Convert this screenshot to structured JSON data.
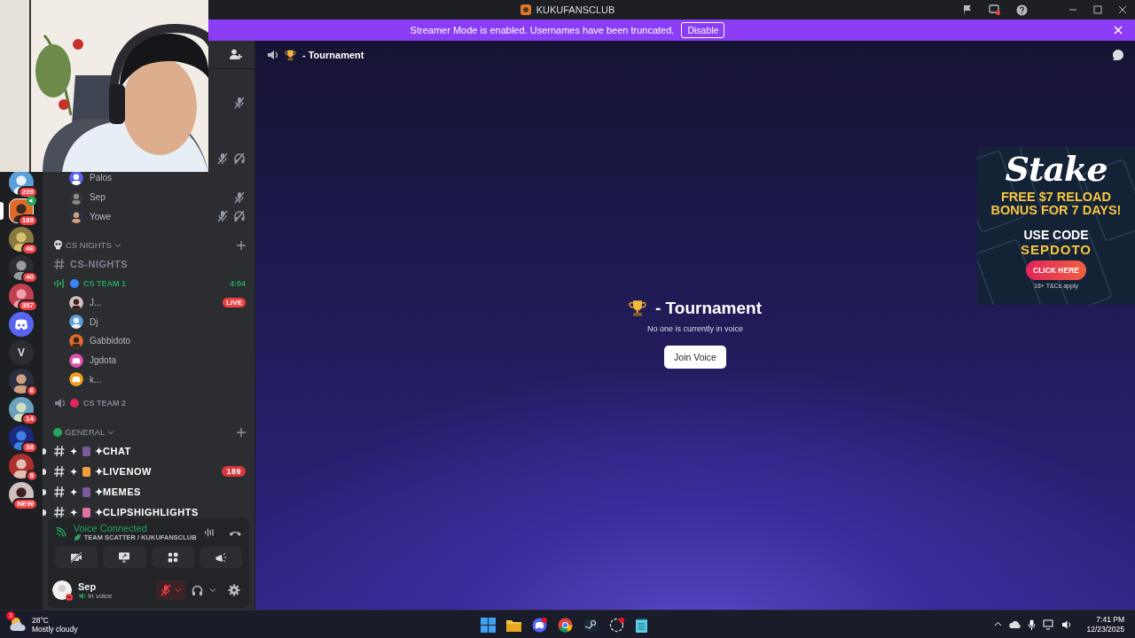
{
  "window": {
    "title": "KUKUFANSCLUB"
  },
  "banner": {
    "text": "Streamer Mode is enabled. Usernames have been truncated.",
    "button": "Disable"
  },
  "servers": [
    {
      "kind": "avatar",
      "badge": "239",
      "selected": false,
      "in_voice": false
    },
    {
      "kind": "avatar",
      "badge": "189",
      "selected": true,
      "in_voice": true
    },
    {
      "kind": "avatar",
      "badge": "46",
      "selected": false,
      "in_voice": false
    },
    {
      "kind": "avatar",
      "badge": "40",
      "selected": false,
      "in_voice": false
    },
    {
      "kind": "avatar",
      "badge": "357",
      "selected": false,
      "in_voice": false
    },
    {
      "kind": "discord",
      "selected": false,
      "in_voice": false
    },
    {
      "kind": "letter",
      "label": "V",
      "selected": false,
      "in_voice": false
    },
    {
      "kind": "avatar",
      "badge": "6",
      "selected": false,
      "in_voice": false
    },
    {
      "kind": "avatar",
      "badge": "14",
      "selected": false,
      "in_voice": false
    },
    {
      "kind": "avatar",
      "badge": "38",
      "selected": false,
      "in_voice": false
    },
    {
      "kind": "avatar",
      "badge": "8",
      "selected": false,
      "in_voice": false
    },
    {
      "kind": "avatar",
      "badge": "NEW",
      "selected": false,
      "in_voice": false
    }
  ],
  "channels": [
    {
      "kind": "member",
      "muted": true,
      "deafened": false
    },
    {
      "kind": "member",
      "muted": true,
      "deafened": true
    },
    {
      "kind": "member",
      "name": "Palos",
      "muted": false,
      "deafened": false
    },
    {
      "kind": "member",
      "name": "Sep",
      "muted": true,
      "deafened": false
    },
    {
      "kind": "member",
      "name": "Yowe",
      "muted": true,
      "deafened": true
    },
    {
      "kind": "category",
      "name": "CS NIGHTS"
    },
    {
      "kind": "text",
      "name": "CS-NIGHTS",
      "unread": false
    },
    {
      "kind": "voice",
      "name": "CS TEAM 1",
      "color": "#3b82f6",
      "active": true,
      "timer": "4:04"
    },
    {
      "kind": "member",
      "name": "J...",
      "muted": false,
      "deafened": false,
      "badge": "LIVE"
    },
    {
      "kind": "member",
      "name": "Dj",
      "muted": false,
      "deafened": false
    },
    {
      "kind": "member",
      "name": "Gabbidoto",
      "muted": false,
      "deafened": false
    },
    {
      "kind": "member",
      "name": "Jgdota",
      "muted": false,
      "deafened": false,
      "color": "#e04fb0"
    },
    {
      "kind": "member",
      "name": "k...",
      "muted": false,
      "deafened": false,
      "color": "#f0a020"
    },
    {
      "kind": "voice",
      "name": "CS TEAM 2",
      "color": "#e0245e",
      "active": false
    },
    {
      "kind": "category",
      "name": "GENERAL",
      "color": "#23a55a"
    },
    {
      "kind": "text",
      "prefix": "✦",
      "name": "✦CHAT",
      "unread": true
    },
    {
      "kind": "text",
      "prefix": "✦",
      "name": "✦LIVENOW",
      "unread": true,
      "badge": "189"
    },
    {
      "kind": "text",
      "prefix": "✦",
      "name": "✦MEMES",
      "unread": true
    },
    {
      "kind": "text",
      "prefix": "✦",
      "name": "✦CLIPSHIGHLIGHTS",
      "unread": true
    }
  ],
  "voice_panel": {
    "status": "Voice Connected",
    "location": "TEAM SCATTER / KUKUFANSCLUB"
  },
  "user": {
    "name": "Sep",
    "status": "In voice",
    "muted": true
  },
  "main": {
    "header": "- Tournament",
    "title": "- Tournament",
    "subtitle": "No one is currently in voice",
    "button": "Join Voice"
  },
  "ad": {
    "brand": "Stake",
    "headline": "FREE $7 RELOAD BONUS FOR 7 DAYS!",
    "code_label": "USE CODE",
    "code": "SEPDOTO",
    "button": "CLICK HERE",
    "fine_print": "18+ T&Cs apply"
  },
  "taskbar": {
    "weather": {
      "badge": "3",
      "temp": "28°C",
      "desc": "Mostly cloudy"
    },
    "clock": {
      "time": "7:41 PM",
      "date": "12/23/2025"
    }
  }
}
